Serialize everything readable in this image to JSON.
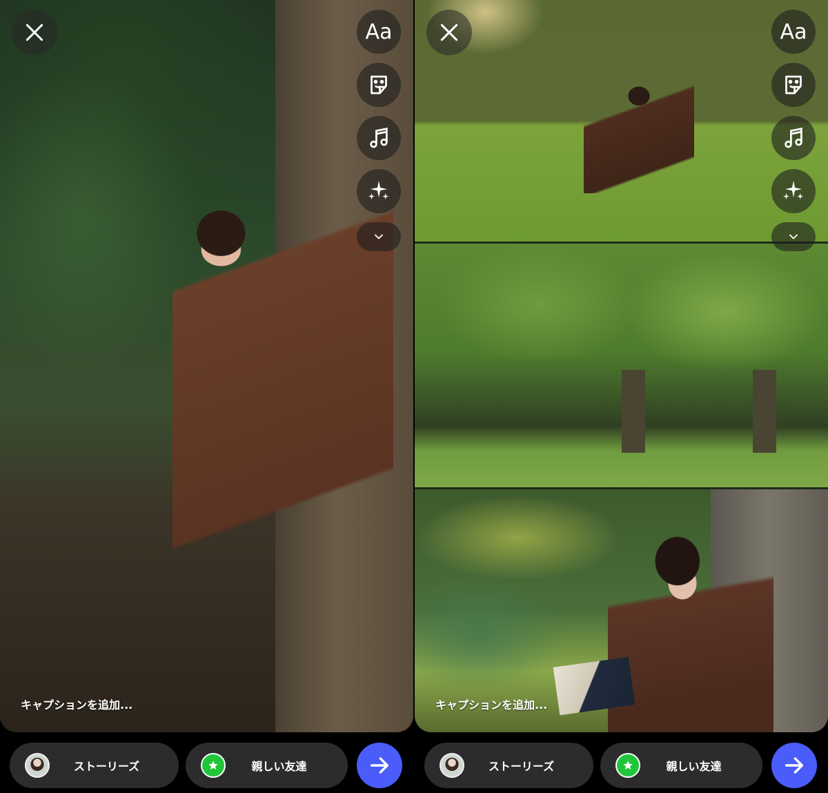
{
  "panels": [
    {
      "caption_placeholder": "キャプションを追加...",
      "tools": {
        "text_label": "Aa",
        "icons": [
          "sticker-icon",
          "music-icon",
          "sparkle-effects-icon",
          "chevron-down-icon"
        ]
      },
      "photos": [
        "forest-tree-portrait"
      ],
      "bottom_bar": {
        "stories_label": "ストーリーズ",
        "close_friends_label": "親しい友達"
      }
    },
    {
      "caption_placeholder": "キャプションを追加...",
      "tools": {
        "text_label": "Aa",
        "icons": [
          "sticker-icon",
          "music-icon",
          "sparkle-effects-icon",
          "chevron-down-icon"
        ]
      },
      "photos": [
        "meadow-reading",
        "park-trees",
        "tree-reading-portrait"
      ],
      "bottom_bar": {
        "stories_label": "ストーリーズ",
        "close_friends_label": "親しい友達"
      }
    }
  ],
  "colors": {
    "send_button": "#4a5dfa",
    "close_friends_badge": "#21c53a",
    "pill_background": "#2c2c2e"
  }
}
